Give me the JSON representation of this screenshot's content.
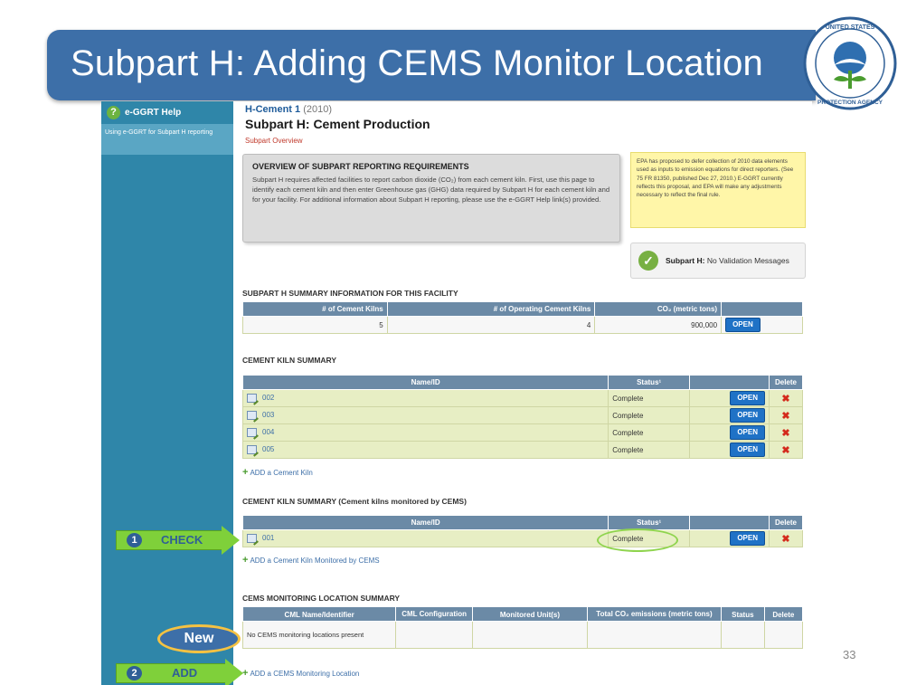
{
  "slide": {
    "title": "Subpart H: Adding CEMS Monitor Location",
    "page_number": "33",
    "logo_text": "UNITED STATES ENVIRONMENTAL PROTECTION AGENCY"
  },
  "sidebar": {
    "help_label": "e-GGRT Help",
    "help_icon": "question-icon",
    "link_label": "Using e-GGRT for Subpart H reporting"
  },
  "header": {
    "facility": "H-Cement 1",
    "year": "(2010)",
    "subpart_title": "Subpart H: Cement Production",
    "overview_link": "Subpart Overview"
  },
  "overview": {
    "heading": "OVERVIEW OF SUBPART REPORTING REQUIREMENTS",
    "body": "Subpart H requires affected facilities to report carbon dioxide (CO₂) from each cement kiln. First, use this page to identify each cement kiln and then enter Greenhouse gas (GHG) data required by Subpart H for each cement kiln and for your facility. For additional information about Subpart H reporting, please use the e-GGRT Help link(s) provided."
  },
  "notice": "EPA has proposed to defer collection of 2010 data elements used as inputs to emission equations for direct reporters. (See 75 FR 81350, published Dec 27, 2010.) E-GGRT currently reflects this proposal, and EPA will make any adjustments necessary to reflect the final rule.",
  "validation": {
    "label": "Subpart H:",
    "message": "No Validation Messages"
  },
  "summary": {
    "heading": "SUBPART H SUMMARY INFORMATION FOR THIS FACILITY",
    "columns": [
      "# of Cement Kilns",
      "# of Operating Cement Kilns",
      "CO₂ (metric tons)",
      ""
    ],
    "kilns": "5",
    "operating": "4",
    "co2": "900,000",
    "open_label": "OPEN"
  },
  "kiln_summary": {
    "heading": "CEMENT KILN SUMMARY",
    "columns": [
      "Name/ID",
      "Status¹",
      "",
      "Delete"
    ],
    "rows": [
      {
        "name": "002",
        "status": "Complete"
      },
      {
        "name": "003",
        "status": "Complete"
      },
      {
        "name": "004",
        "status": "Complete"
      },
      {
        "name": "005",
        "status": "Complete"
      }
    ],
    "open_label": "OPEN",
    "add_label": "ADD a Cement Kiln"
  },
  "cems_kiln_summary": {
    "heading": "CEMENT KILN SUMMARY (Cement kilns monitored by CEMS)",
    "columns": [
      "Name/ID",
      "Status¹",
      "",
      "Delete"
    ],
    "row": {
      "name": "001",
      "status": "Complete"
    },
    "open_label": "OPEN",
    "add_label": "ADD a Cement Kiln Monitored by CEMS"
  },
  "cml_summary": {
    "heading": "CEMS MONITORING LOCATION SUMMARY",
    "columns": [
      "CML Name/Identifier",
      "CML Configuration",
      "Monitored Unit(s)",
      "Total CO₂ emissions (metric tons)",
      "Status",
      "Delete"
    ],
    "empty_text": "No CEMS monitoring locations present",
    "add_label": "ADD a CEMS Monitoring Location"
  },
  "callouts": {
    "step1_num": "1",
    "step1_label": "CHECK",
    "step2_num": "2",
    "step2_label": "ADD",
    "new_label": "New"
  },
  "colors": {
    "banner": "#3d6fa8",
    "sidebar": "#2f86a9",
    "callout_green": "#7fd03a",
    "row_green": "#e7eec4",
    "open_button": "#1f72c6"
  }
}
